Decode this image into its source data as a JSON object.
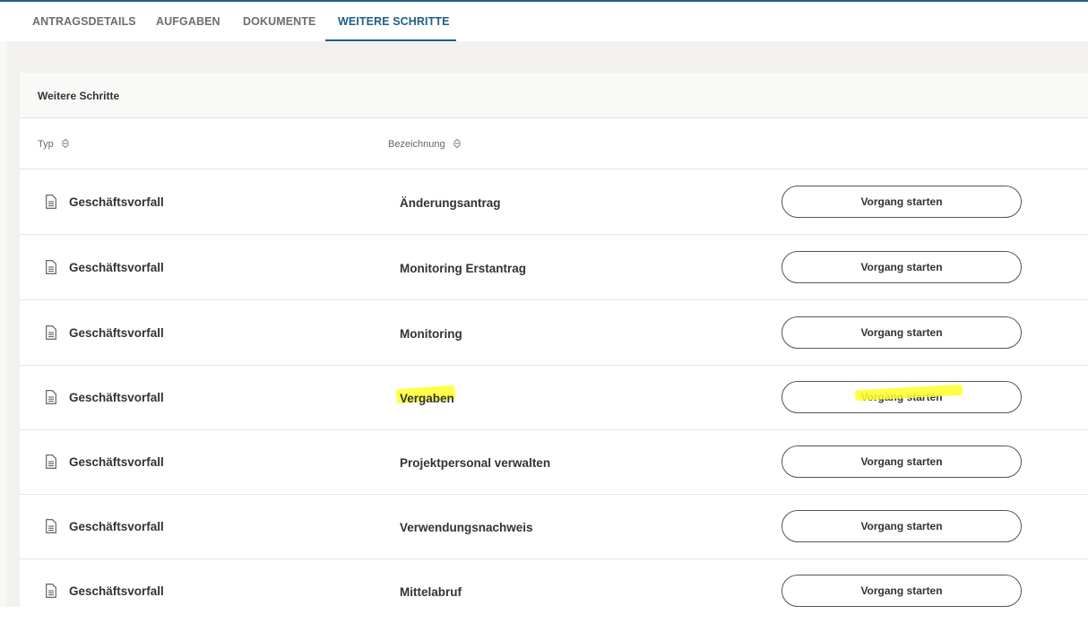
{
  "tabs": [
    {
      "label": "ANTRAGSDETAILS",
      "active": false
    },
    {
      "label": "AUFGABEN",
      "active": false
    },
    {
      "label": "DOKUMENTE",
      "active": false
    },
    {
      "label": "WEITERE SCHRITTE",
      "active": true
    }
  ],
  "card": {
    "title": "Weitere Schritte",
    "columns": {
      "type": "Typ",
      "name": "Bezeichnung"
    }
  },
  "rows": [
    {
      "icon": "document-icon",
      "type": "Geschäftsvorfall",
      "name": "Änderungsantrag",
      "action": "Vorgang starten"
    },
    {
      "icon": "document-icon",
      "type": "Geschäftsvorfall",
      "name": "Monitoring Erstantrag",
      "action": "Vorgang starten"
    },
    {
      "icon": "document-icon",
      "type": "Geschäftsvorfall",
      "name": "Monitoring",
      "action": "Vorgang starten"
    },
    {
      "icon": "document-icon",
      "type": "Geschäftsvorfall",
      "name": "Vergaben",
      "action": "Vorgang starten",
      "highlighted": true
    },
    {
      "icon": "document-icon",
      "type": "Geschäftsvorfall",
      "name": "Projektpersonal verwalten",
      "action": "Vorgang starten"
    },
    {
      "icon": "document-icon",
      "type": "Geschäftsvorfall",
      "name": "Verwendungsnachweis",
      "action": "Vorgang starten"
    },
    {
      "icon": "document-icon",
      "type": "Geschäftsvorfall",
      "name": "Mittelabruf",
      "action": "Vorgang starten"
    }
  ],
  "colors": {
    "accent": "#1f5f86",
    "highlight": "#ffff2a",
    "background": "#f2f1ef"
  }
}
